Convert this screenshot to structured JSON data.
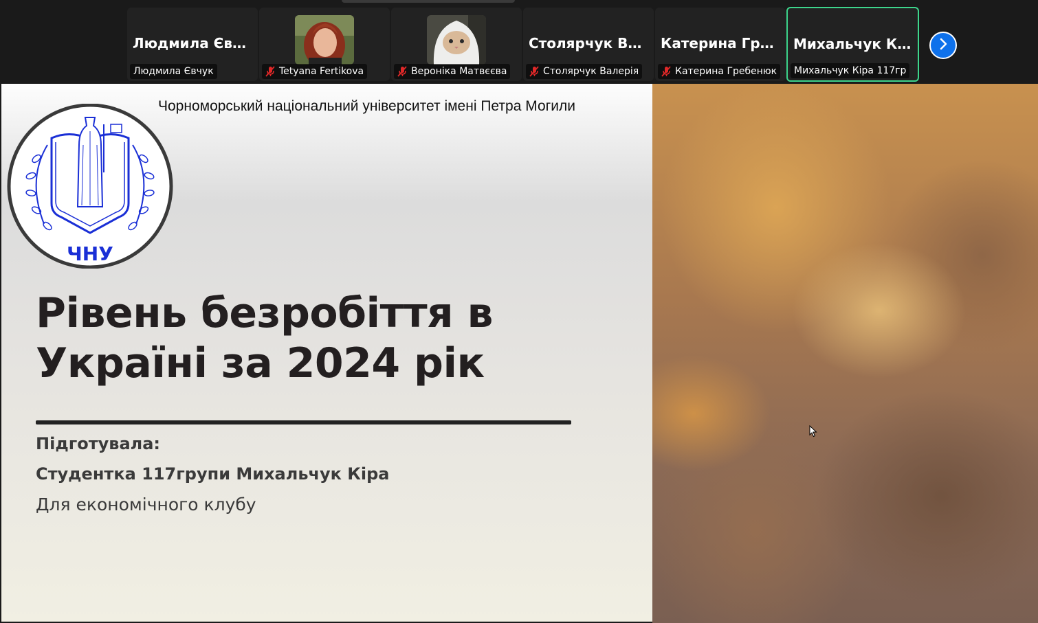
{
  "participants": [
    {
      "display_name": "Людмила Євчук",
      "label": "Людмила Євчук",
      "muted": false,
      "video": false,
      "active": false
    },
    {
      "display_name": "",
      "label": "Tetyana Fertikova",
      "muted": true,
      "video": true,
      "active": false
    },
    {
      "display_name": "",
      "label": "Вероніка Матвєєва",
      "muted": true,
      "video": true,
      "active": false
    },
    {
      "display_name": "Столярчук Вал...",
      "label": "Столярчук Валерія",
      "muted": true,
      "video": false,
      "active": false
    },
    {
      "display_name": "Катерина Гребе...",
      "label": "Катерина Гребенюк",
      "muted": true,
      "video": false,
      "active": false
    },
    {
      "display_name": "Михальчук Кір...",
      "label": "Михальчук Кіра 117гр",
      "muted": false,
      "video": false,
      "active": true
    }
  ],
  "icons": {
    "mute": "microphone-muted-icon",
    "next": "chevron-right-icon",
    "cursor": "mouse-pointer-icon"
  },
  "colors": {
    "accent_active": "#3dd68c",
    "next_button": "#0e71eb",
    "mute_red": "#e02828",
    "logo_blue": "#1a2fd6"
  },
  "slide": {
    "university": "Чорноморський національний університет імені Петра Могили",
    "logo_text": "ЧНУ",
    "title_line1": "Рівень безробіття в",
    "title_line2": "Україні за 2024 рік",
    "prepared_by": "Підготувала:",
    "student": "Студентка 117групи Михальчук Кіра",
    "club": "Для економічного клубу"
  }
}
